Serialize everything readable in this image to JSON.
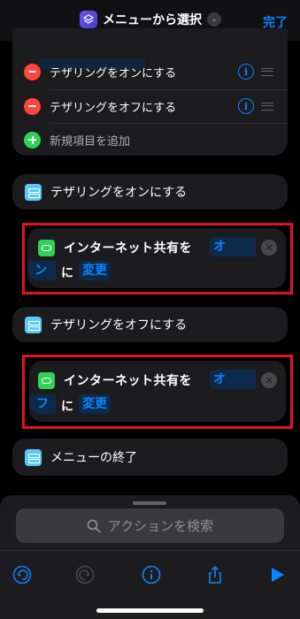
{
  "nav": {
    "title": "メニューから選択",
    "done_label": "完了"
  },
  "menu_card": {
    "items": [
      {
        "label": "テザリングをオンにする",
        "control": "minus-circle"
      },
      {
        "label": "テザリングをオフにする",
        "control": "minus-circle"
      }
    ],
    "add_label": "新規項目を追加"
  },
  "flow": {
    "case_on_label": "テザリングをオンにする",
    "block_on": {
      "text_1": "インターネット共有を",
      "token_value": "オン",
      "token_value_wrap_a": "オ",
      "token_value_wrap_b": "ン",
      "text_2": "に",
      "token_action": "変更"
    },
    "case_off_label": "テザリングをオフにする",
    "block_off": {
      "text_1": "インターネット共有を",
      "token_value": "オフ",
      "token_value_wrap_a": "オ",
      "token_value_wrap_b": "フ",
      "text_2": "に",
      "token_action": "変更"
    },
    "end_label": "メニューの終了"
  },
  "search": {
    "placeholder": "アクションを検索"
  },
  "toolbar": {
    "icons": [
      "undo-icon",
      "redo-icon",
      "info-icon",
      "share-icon",
      "play-icon"
    ]
  },
  "colors": {
    "accent": "#0a84ff",
    "highlight_outline": "#e3131b",
    "delete": "#ff453a",
    "add": "#30d158",
    "scripting": "#5ac8fa"
  }
}
